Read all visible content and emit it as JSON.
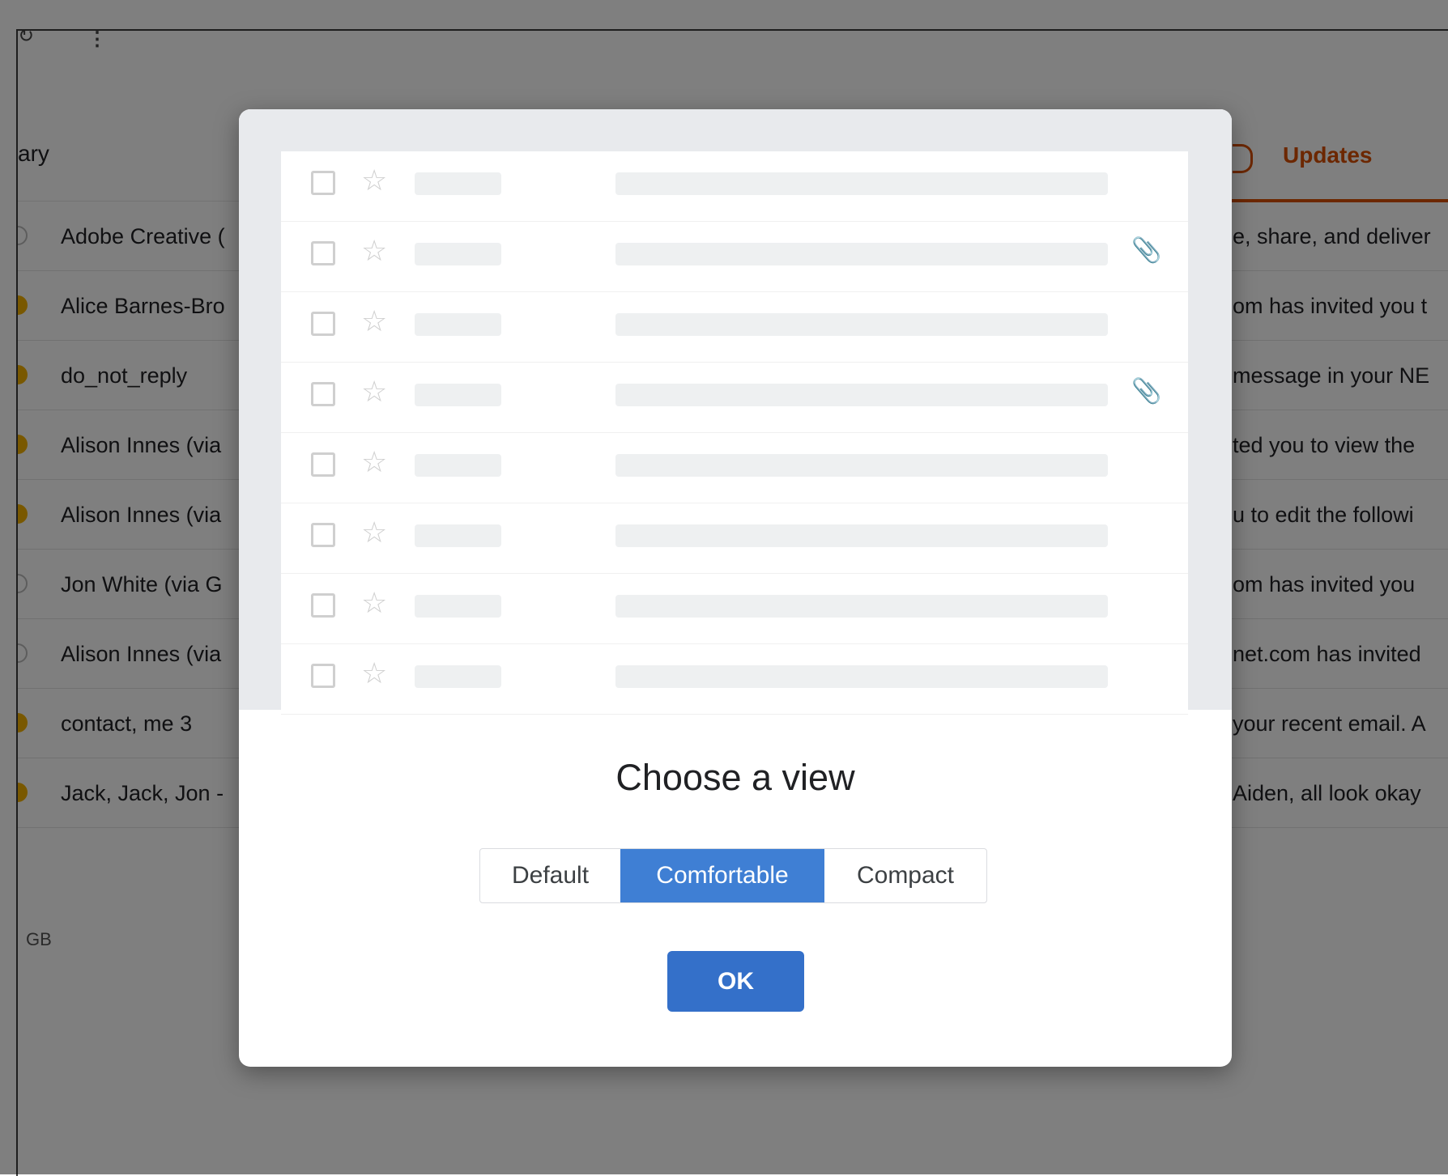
{
  "toolbar": {
    "refresh_icon": "refresh-icon",
    "more_glyph": "⋮"
  },
  "tabs": {
    "primary_label": "ary",
    "updates_label": "Updates"
  },
  "emails": [
    {
      "sender": "Adobe Creative (",
      "snippet": "e, share, and deliver",
      "important": false
    },
    {
      "sender": "Alice Barnes-Bro",
      "snippet": "om has invited you t",
      "important": true
    },
    {
      "sender": "do_not_reply",
      "snippet": "message in your NE",
      "important": true
    },
    {
      "sender": "Alison Innes (via",
      "snippet": "ted you to view the",
      "important": true
    },
    {
      "sender": "Alison Innes (via",
      "snippet": "u to edit the followi",
      "important": true
    },
    {
      "sender": "Jon White (via G",
      "snippet": "om has invited you",
      "important": false
    },
    {
      "sender": "Alison Innes (via",
      "snippet": "net.com has invited",
      "important": false
    },
    {
      "sender": "contact, me 3",
      "snippet": "your recent email. A",
      "important": true
    },
    {
      "sender": "Jack, Jack, Jon -",
      "snippet": "Aiden, all look okay",
      "important": true
    }
  ],
  "storage": {
    "text": "GB"
  },
  "modal": {
    "title": "Choose a view",
    "preview_rows": [
      {
        "attachment": false
      },
      {
        "attachment": true
      },
      {
        "attachment": false
      },
      {
        "attachment": true
      },
      {
        "attachment": false
      },
      {
        "attachment": false
      },
      {
        "attachment": false
      },
      {
        "attachment": false
      }
    ],
    "options": [
      {
        "id": "default",
        "label": "Default",
        "selected": false
      },
      {
        "id": "comfortable",
        "label": "Comfortable",
        "selected": true
      },
      {
        "id": "compact",
        "label": "Compact",
        "selected": false
      }
    ],
    "ok_label": "OK"
  },
  "colors": {
    "accent": "#3f7fd4",
    "ok_button": "#3470c9",
    "updates_tab": "#d94f00",
    "important_marker": "#f2b100"
  }
}
